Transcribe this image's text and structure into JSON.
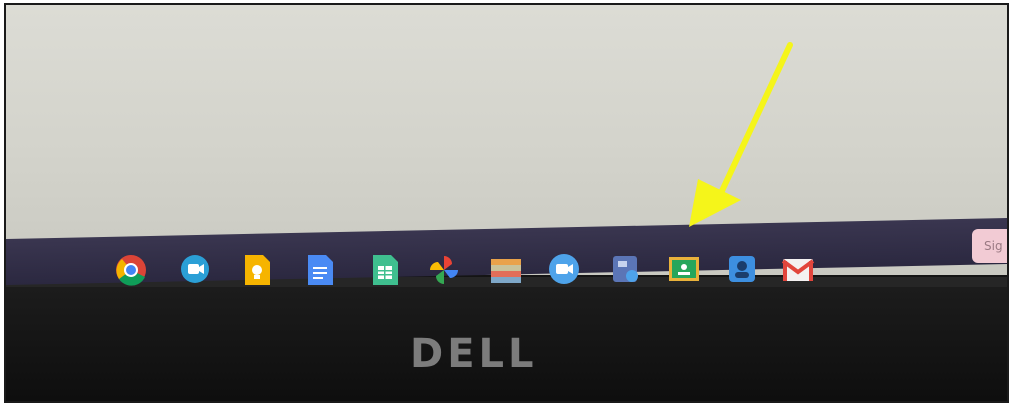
{
  "brand": {
    "text": "DELL"
  },
  "shelf": {
    "apps": [
      {
        "icon": "chrome-icon"
      },
      {
        "icon": "google-meet-icon"
      },
      {
        "icon": "google-keep-icon"
      },
      {
        "icon": "google-docs-icon"
      },
      {
        "icon": "google-sheets-icon"
      },
      {
        "icon": "google-photos-icon"
      },
      {
        "icon": "books-icon"
      },
      {
        "icon": "video-call-icon"
      },
      {
        "icon": "files-icon"
      },
      {
        "icon": "google-classroom-icon"
      },
      {
        "icon": "account-icon"
      },
      {
        "icon": "gmail-icon"
      }
    ],
    "sign_button_label": "Sig"
  },
  "annotation": {
    "arrow_color": "#f5f51a"
  },
  "colors": {
    "shelf": "#332f48",
    "screen": "#d6d6ce",
    "bezel": "#141414"
  }
}
